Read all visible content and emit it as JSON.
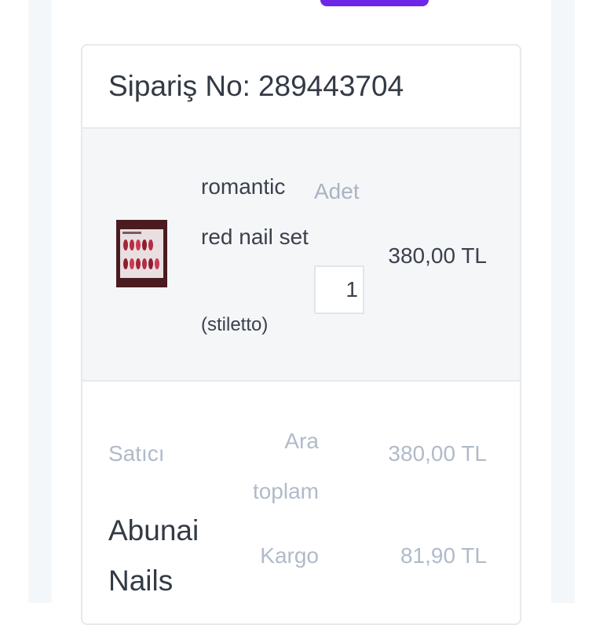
{
  "order": {
    "label": "Sipariş No:",
    "number": "289443704"
  },
  "item": {
    "name": "romantic red nail set",
    "variant": "(stiletto)",
    "quantity_label": "Adet",
    "quantity_value": "1",
    "price": "380,00 TL",
    "thumbnail_icon": "nail-set-product-image"
  },
  "summary": {
    "seller_label": "Satıcı",
    "seller_name": "Abunai Nails",
    "subtotal_label": "Ara toplam",
    "subtotal_value": "380,00 TL",
    "shipping_label": "Kargo",
    "shipping_value": "81,90 TL"
  },
  "colors": {
    "accent": "#6c27e8",
    "text": "#333a45",
    "muted": "#b0bbc9",
    "border": "#e6e9ee",
    "row_bg": "#f5f6f8"
  }
}
